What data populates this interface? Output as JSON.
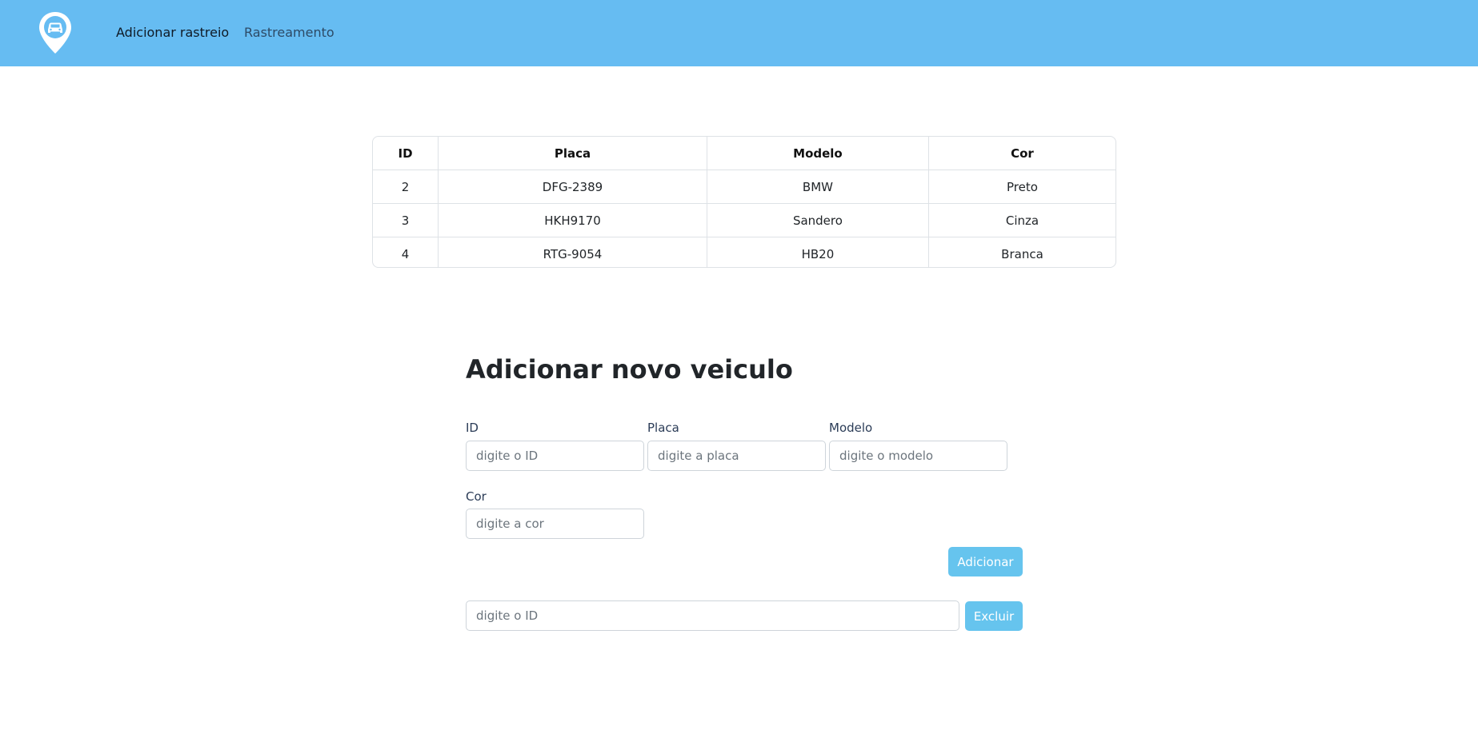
{
  "navbar": {
    "logo_icon": "car-location-pin-icon",
    "links": [
      "Adicionar rastreio",
      "Rastreamento"
    ],
    "background": "#66bcf2"
  },
  "vehicles_table": {
    "columns": [
      "ID",
      "Placa",
      "Modelo",
      "Cor"
    ],
    "rows": [
      [
        "2",
        "DFG-2389",
        "BMW",
        "Preto"
      ],
      [
        "3",
        "HKH9170",
        "Sandero",
        "Cinza"
      ],
      [
        "4",
        "RTG-9054",
        "HB20",
        "Branca"
      ]
    ]
  },
  "add_form": {
    "title": "Adicionar novo veiculo",
    "fields": {
      "id": {
        "label": "ID",
        "placeholder": "digite o ID",
        "value": ""
      },
      "placa": {
        "label": "Placa",
        "placeholder": "digite a placa",
        "value": ""
      },
      "modelo": {
        "label": "Modelo",
        "placeholder": "digite o modelo",
        "value": ""
      },
      "cor": {
        "label": "Cor",
        "placeholder": "digite a cor",
        "value": ""
      }
    },
    "submit_label": "Adicionar"
  },
  "delete_form": {
    "placeholder": "digite o ID",
    "value": "",
    "submit_label": "Excluir"
  },
  "colors": {
    "navbar": "#66bcf2",
    "button": "#66c4ee"
  }
}
